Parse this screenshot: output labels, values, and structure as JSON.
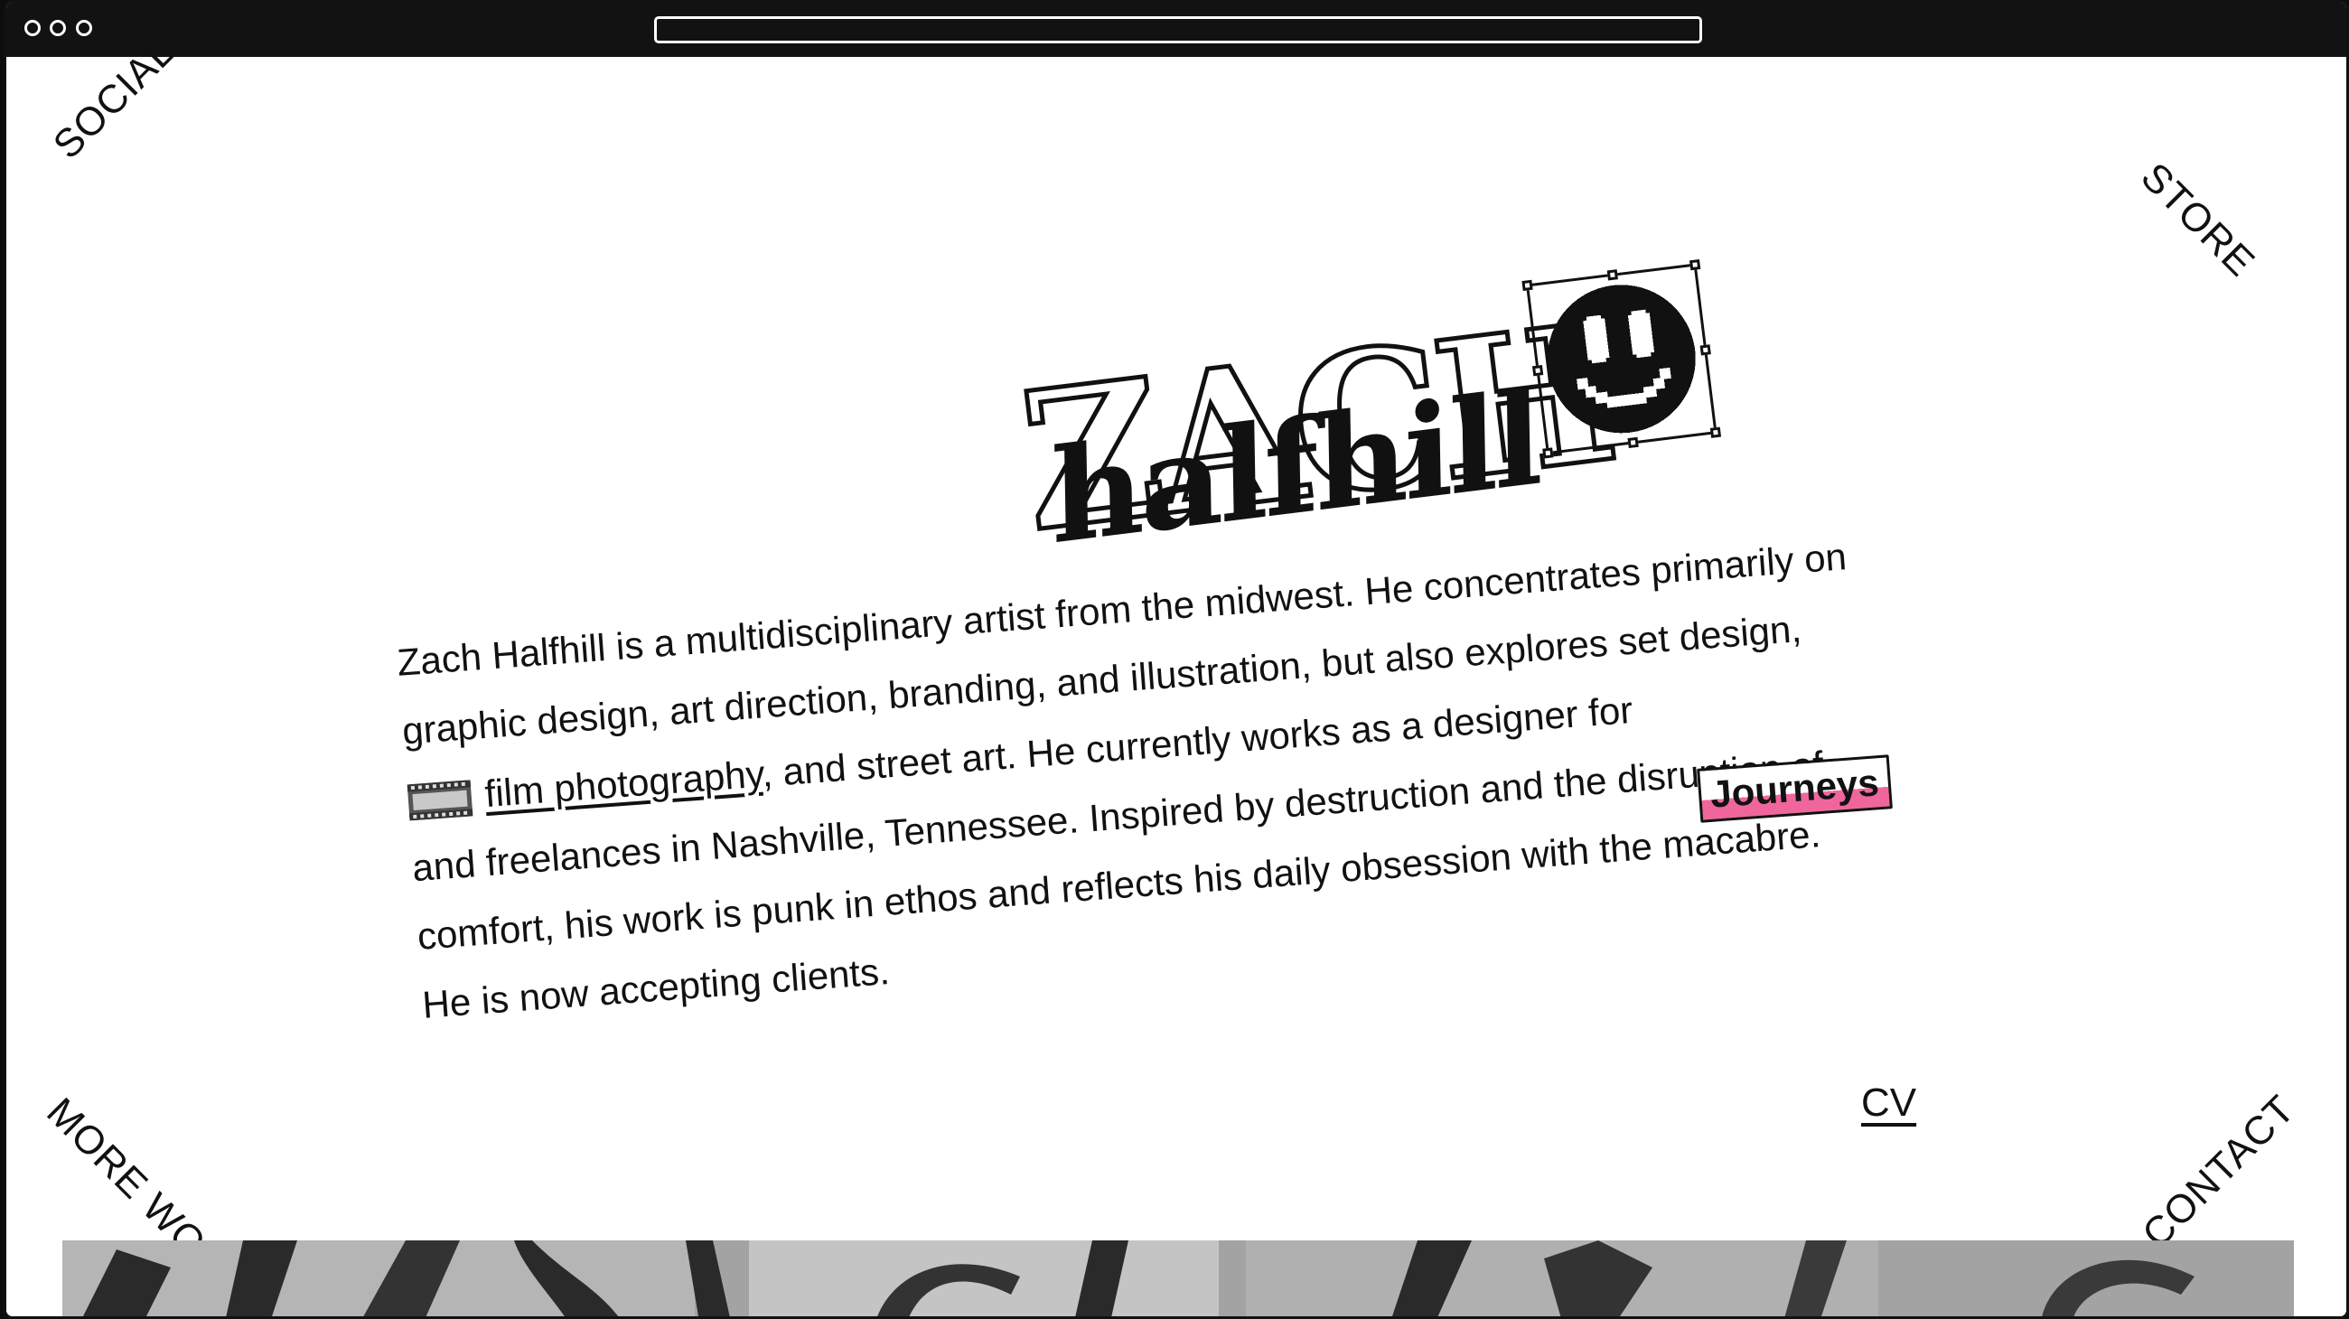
{
  "browser": {
    "traffic_lights": [
      "close-dot",
      "minimize-dot",
      "maximize-dot"
    ],
    "address_bar_value": ""
  },
  "nav": {
    "top_left": "SOCIAL",
    "top_right": "STORE",
    "bottom_left": "MORE WORK",
    "bottom_right": "CONTACT"
  },
  "logo": {
    "line1": "ZACH",
    "line2": "halfhill",
    "icon": "pixel-smiley-icon"
  },
  "bio": {
    "l1": "Zach Halfhill is a multidisciplinary artist from the midwest. He concentrates primarily on",
    "l2": "graphic design, art direction, branding, and illustration, but also explores set design,",
    "l3_link": "film photography",
    "l3_rest": ", and street art. He currently works as a designer for",
    "employer": "Journeys",
    "l4": "and freelances in Nashville, Tennessee. Inspired by destruction and the disruption of",
    "l5": "comfort, his work is punk in ethos and reflects his daily obsession with the macabre.",
    "l6": "He is now accepting clients."
  },
  "cv_link": "CV",
  "colors": {
    "frame": "#121212",
    "background": "#ffffff",
    "text": "#111111",
    "highlight": "#f0669c"
  }
}
